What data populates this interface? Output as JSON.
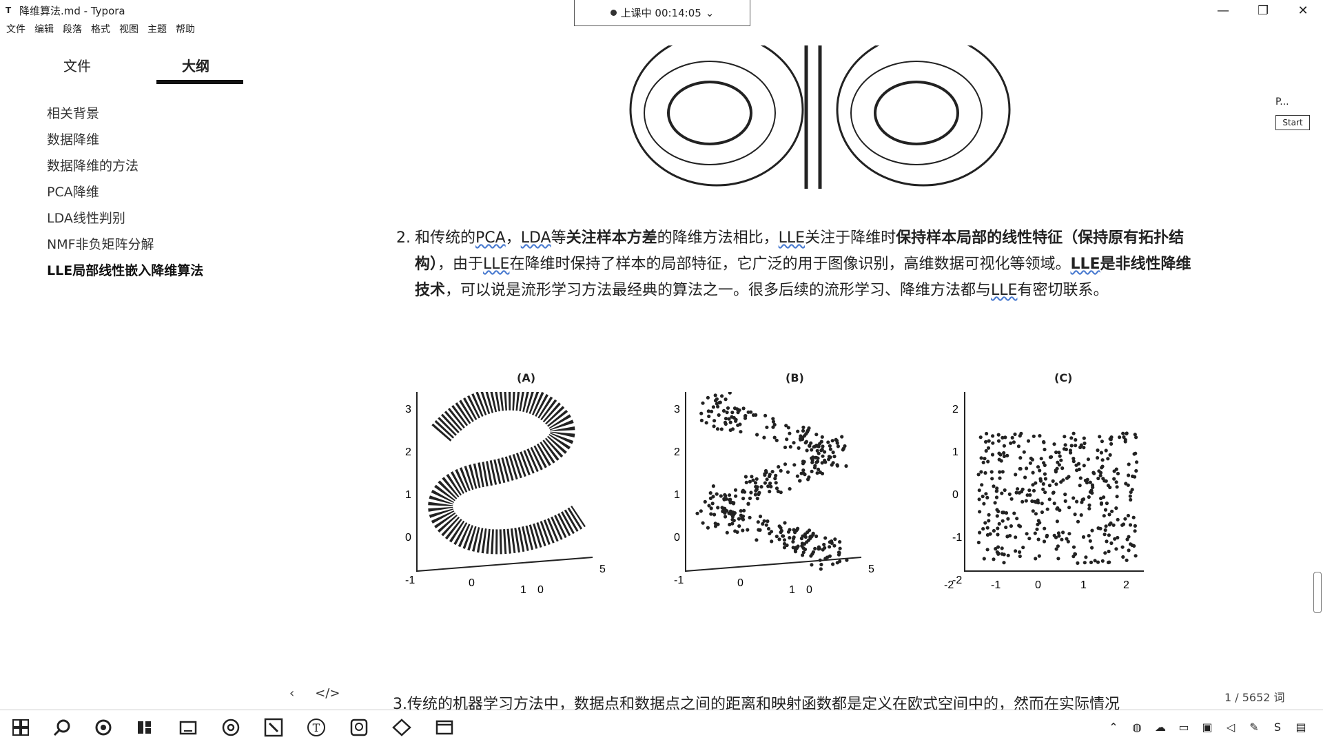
{
  "window": {
    "title": "降维算法.md - Typora",
    "app_icon": "T",
    "class_timer": "上课中 00:14:05",
    "controls": [
      "—",
      "❐",
      "✕"
    ]
  },
  "menu": [
    "文件",
    "编辑",
    "段落",
    "格式",
    "视图",
    "主题",
    "帮助"
  ],
  "sidebar": {
    "tabs": [
      "文件",
      "大纲"
    ],
    "active_tab": "大纲",
    "outline": [
      {
        "label": "相关背景",
        "active": false
      },
      {
        "label": "数据降维",
        "active": false
      },
      {
        "label": "数据降维的方法",
        "active": false
      },
      {
        "label": "PCA降维",
        "active": false
      },
      {
        "label": "LDA线性判别",
        "active": false
      },
      {
        "label": "NMF非负矩阵分解",
        "active": false
      },
      {
        "label": "LLE局部线性嵌入降维算法",
        "active": true
      }
    ]
  },
  "paragraph2": {
    "number": "2.",
    "segments": [
      {
        "t": "和传统的",
        "s": ""
      },
      {
        "t": "PCA",
        "s": "ul"
      },
      {
        "t": "，",
        "s": ""
      },
      {
        "t": "LDA",
        "s": "ul"
      },
      {
        "t": "等",
        "s": ""
      },
      {
        "t": "关注样本方差",
        "s": "b"
      },
      {
        "t": "的降维方法相比，",
        "s": ""
      },
      {
        "t": "LLE",
        "s": "ul"
      },
      {
        "t": "关注于降维时",
        "s": ""
      },
      {
        "t": "保持样本局部的线性特征（保持原有拓扑结构）",
        "s": "b"
      },
      {
        "t": "，由于",
        "s": ""
      },
      {
        "t": "LLE",
        "s": "ul"
      },
      {
        "t": "在降维时保持了样本的局部特征，它广泛的用于图像识别，高维数据可视化等领域。",
        "s": ""
      },
      {
        "t": "LLE",
        "s": "bul"
      },
      {
        "t": "是非线性降维技术",
        "s": "b"
      },
      {
        "t": "，可以说是流形学习方法最经典的算法之一。很多后续的流形学习、降维方法都与",
        "s": ""
      },
      {
        "t": "LLE",
        "s": "ul"
      },
      {
        "t": "有密切联系。",
        "s": ""
      }
    ]
  },
  "figure": {
    "panels": [
      {
        "title": "(A)",
        "yticks": [
          "3",
          "2",
          "1",
          "0",
          "-1"
        ],
        "xticks": [
          "0",
          "1",
          "0",
          "5"
        ]
      },
      {
        "title": "(B)",
        "yticks": [
          "3",
          "2",
          "1",
          "0",
          "-1"
        ],
        "xticks": [
          "0",
          "1",
          "0",
          "5"
        ]
      },
      {
        "title": "(C)",
        "yticks": [
          "2",
          "1",
          "0",
          "-1",
          "-2"
        ],
        "xticks": [
          "-2",
          "-1",
          "0",
          "1",
          "2"
        ]
      }
    ]
  },
  "paragraph3": "3.传统的机器学习方法中，数据点和数据点之间的距离和映射函数都是定义在欧式空间中的，然而在实际情况",
  "status": {
    "word_count": "1 / 5652 词",
    "nav_back": "‹",
    "nav_source": "</>"
  },
  "overlay": {
    "caption": "P...",
    "start_label": "Start"
  },
  "taskbar": {
    "icons": [
      "windows-icon",
      "search-icon",
      "cortana-icon",
      "task-view-icon",
      "file-explorer-icon",
      "chrome-icon",
      "pen-app-icon",
      "typora-icon",
      "paint-icon",
      "edu-icon",
      "window-app-icon"
    ],
    "tray": [
      "chevron-up-icon",
      "security-icon",
      "cloud-icon",
      "display-icon",
      "monitor-icon",
      "volume-icon",
      "pen-icon",
      "ime-icon",
      "notification-icon"
    ]
  }
}
